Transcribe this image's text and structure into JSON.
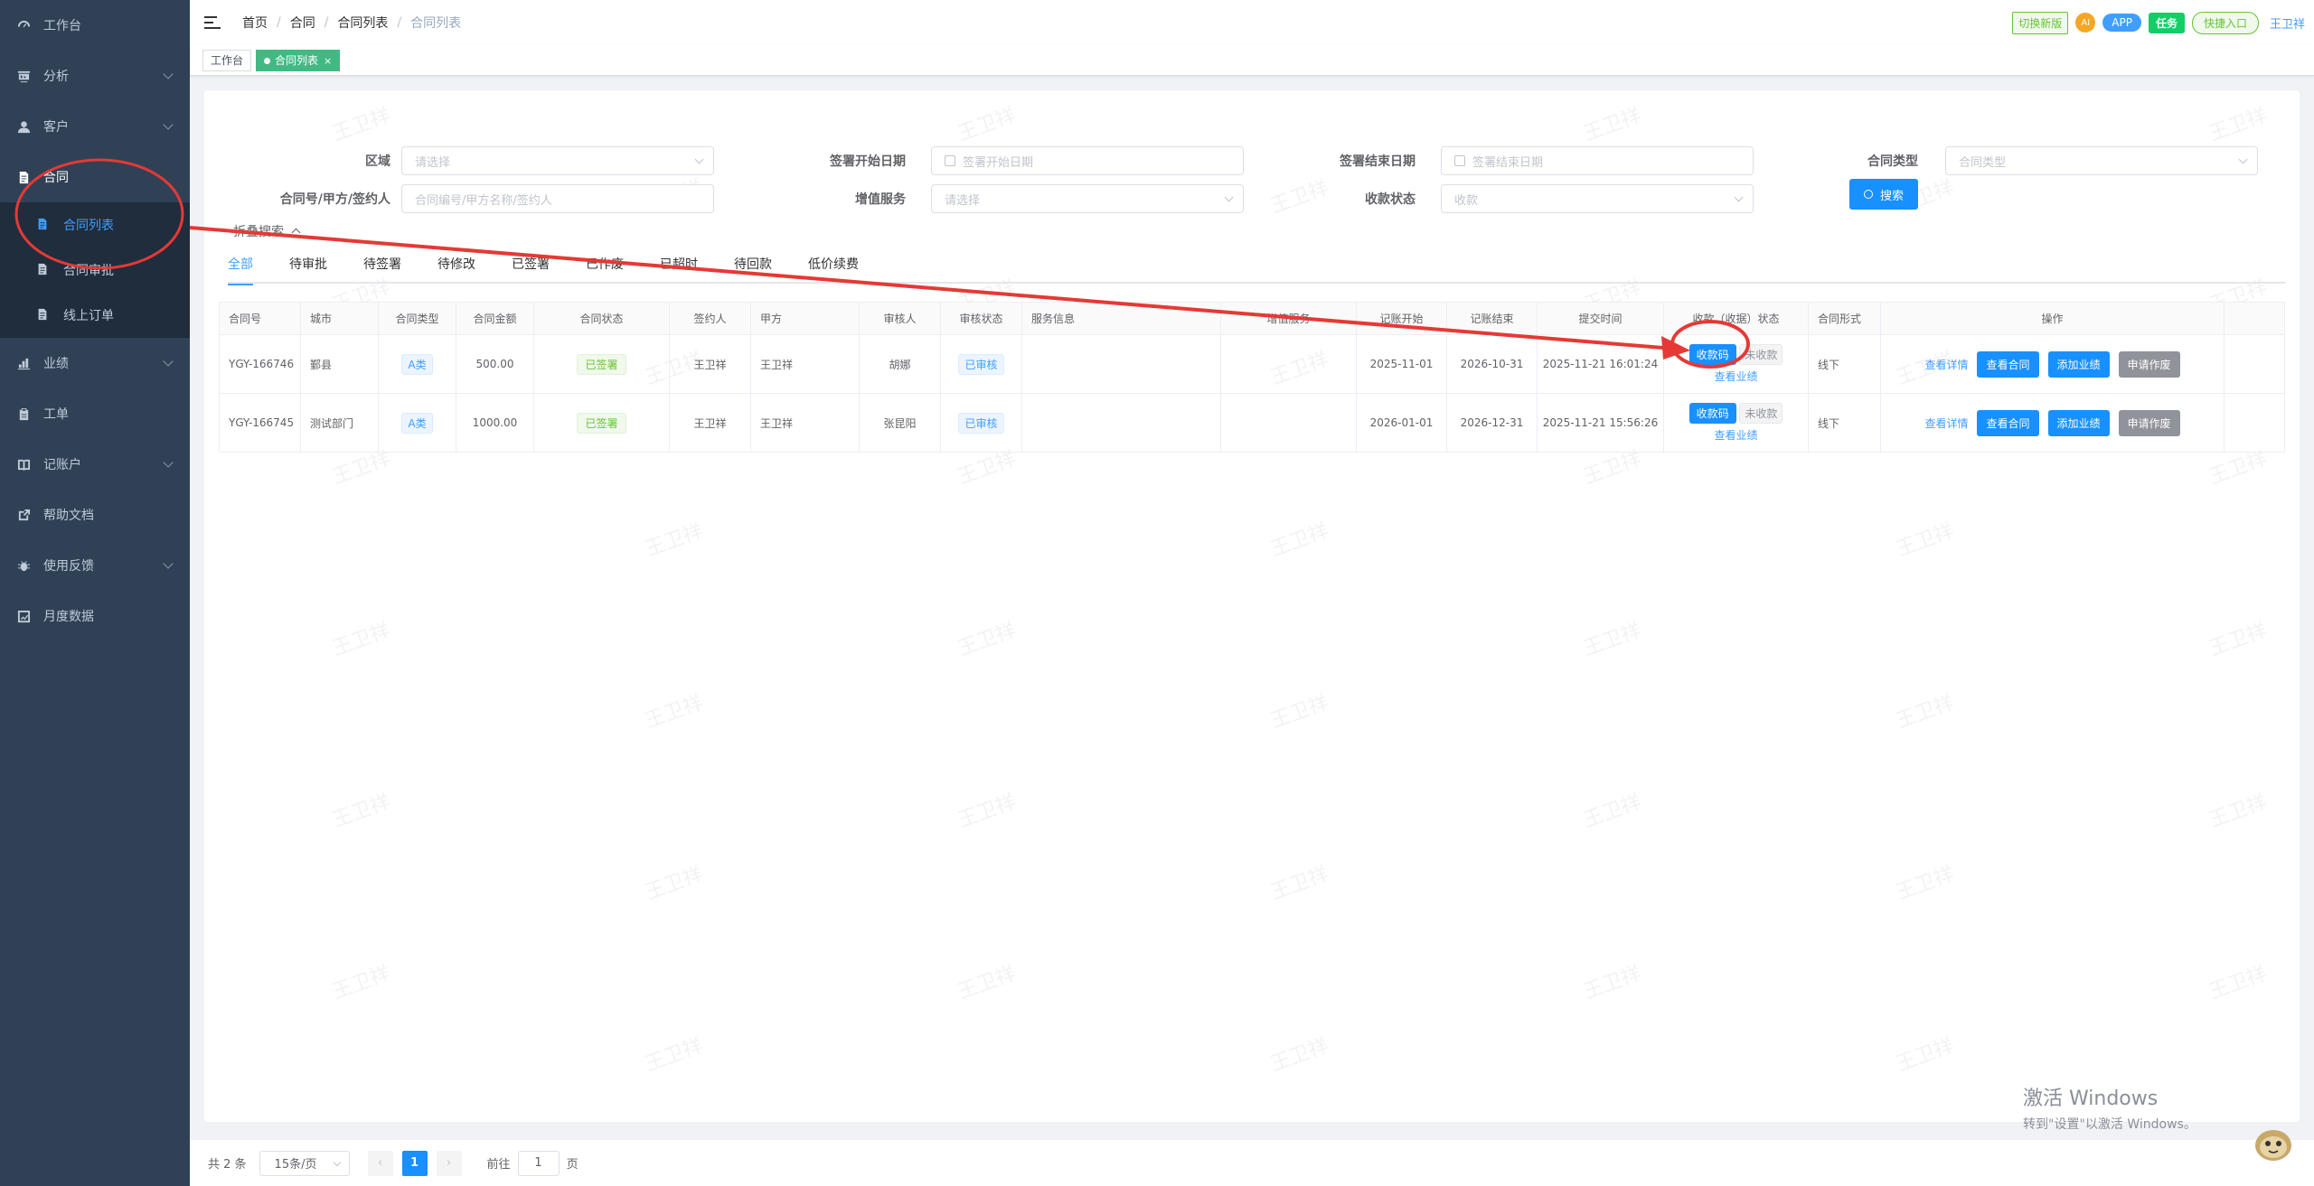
{
  "sidebar": {
    "items": [
      {
        "label": "工作台"
      },
      {
        "label": "分析"
      },
      {
        "label": "客户"
      },
      {
        "label": "合同"
      },
      {
        "label": "合同列表"
      },
      {
        "label": "合同审批"
      },
      {
        "label": "线上订单"
      },
      {
        "label": "业绩"
      },
      {
        "label": "工单"
      },
      {
        "label": "记账户"
      },
      {
        "label": "帮助文档"
      },
      {
        "label": "使用反馈"
      },
      {
        "label": "月度数据"
      }
    ]
  },
  "navbar": {
    "breadcrumb": [
      "首页",
      "合同",
      "合同列表",
      "合同列表"
    ],
    "switch_label": "切换新版",
    "ai_label": "AI",
    "app_label": "APP",
    "task_label": "任务",
    "quick_label": "快捷入口",
    "user": "王卫祥"
  },
  "tags": {
    "home": "工作台",
    "current": "合同列表",
    "close": "×"
  },
  "filters": {
    "region_label": "区域",
    "region_placeholder": "请选择",
    "sign_start_label": "签署开始日期",
    "sign_start_placeholder": "签署开始日期",
    "sign_end_label": "签署结束日期",
    "sign_end_placeholder": "签署结束日期",
    "type_label": "合同类型",
    "type_placeholder": "合同类型",
    "contract_no_label": "合同号/甲方/签约人",
    "contract_no_placeholder": "合同编号/甲方名称/签约人",
    "vas_label": "增值服务",
    "vas_placeholder": "请选择",
    "pay_label": "收款状态",
    "pay_placeholder": "收款",
    "search_label": "搜索",
    "collapse_label": "折叠搜索"
  },
  "tabs": [
    "全部",
    "待审批",
    "待签署",
    "待修改",
    "已签署",
    "已作废",
    "已超时",
    "待回款",
    "低价续费"
  ],
  "table": {
    "headers": [
      "合同号",
      "城市",
      "合同类型",
      "合同金额",
      "合同状态",
      "签约人",
      "甲方",
      "审核人",
      "审核状态",
      "服务信息",
      "增值服务",
      "记账开始",
      "记账结束",
      "提交时间",
      "收款（收据）状态",
      "合同形式",
      "操作"
    ],
    "rows": [
      {
        "no": "YGY-166746",
        "city": "鄞县",
        "type": "A类",
        "amount": "500.00",
        "status": "已签署",
        "signer": "王卫祥",
        "party": "王卫祥",
        "auditor": "胡娜",
        "audit": "已审核",
        "start": "2025-11-01",
        "end": "2026-10-31",
        "submit": "2025-11-21 16:01:24",
        "qr": "收款码",
        "pay": "未收款",
        "perf": "查看业绩",
        "form": "线下",
        "detail": "查看详情",
        "view": "查看合同",
        "add": "添加业绩",
        "void": "申请作废"
      },
      {
        "no": "YGY-166745",
        "city": "测试部门",
        "type": "A类",
        "amount": "1000.00",
        "status": "已签署",
        "signer": "王卫祥",
        "party": "王卫祥",
        "auditor": "张昆阳",
        "audit": "已审核",
        "start": "2026-01-01",
        "end": "2026-12-31",
        "submit": "2025-11-21 15:56:26",
        "qr": "收款码",
        "pay": "未收款",
        "perf": "查看业绩",
        "form": "线下",
        "detail": "查看详情",
        "view": "查看合同",
        "add": "添加业绩",
        "void": "申请作废"
      }
    ]
  },
  "pager": {
    "total": "共 2 条",
    "size": "15条/页",
    "prev": "‹",
    "page": "1",
    "next": "›",
    "goto": "前往",
    "goto_value": "1",
    "unit": "页"
  },
  "watermark": "王卫祥",
  "windows": {
    "line1": "激活 Windows",
    "line2": "转到\"设置\"以激活 Windows。"
  },
  "colors": {
    "sidebar_bg": "#304156",
    "accent": "#409eff",
    "annotation_red": "#e53935"
  }
}
